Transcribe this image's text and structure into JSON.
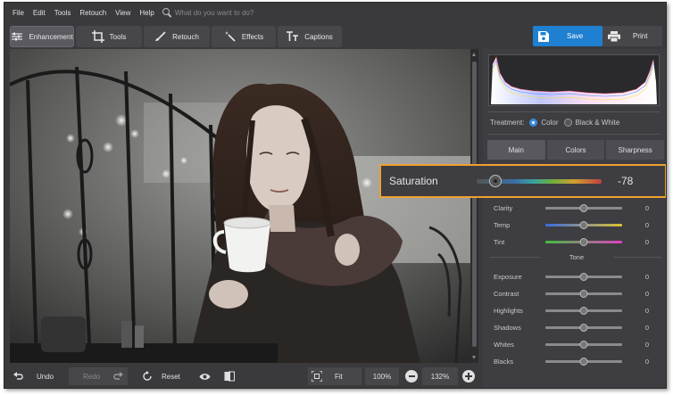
{
  "menu": [
    "File",
    "Edit",
    "Tools",
    "Retouch",
    "View",
    "Help"
  ],
  "search": {
    "placeholder": "What do you want to do?"
  },
  "toolbar": {
    "tabs": [
      {
        "label": "Enhancement",
        "icon": "sliders-icon"
      },
      {
        "label": "Tools",
        "icon": "crop-icon"
      },
      {
        "label": "Retouch",
        "icon": "brush-icon"
      },
      {
        "label": "Effects",
        "icon": "magic-wand-icon"
      },
      {
        "label": "Captions",
        "icon": "text-icon"
      }
    ],
    "save_label": "Save",
    "print_label": "Print"
  },
  "bottom_bar": {
    "undo_label": "Undo",
    "redo_label": "Redo",
    "reset_label": "Reset",
    "fit_label": "Fit",
    "zoom_actual": "100%",
    "zoom_current": "132%"
  },
  "panel": {
    "treatment_label": "Treatment:",
    "treatment_options": [
      "Color",
      "Black & White"
    ],
    "treatment_selected": "Color",
    "tabs": [
      "Main",
      "Colors",
      "Sharpness"
    ],
    "active_tab": "Main",
    "color_sliders": [
      {
        "label": "Clarity",
        "value": "0",
        "level": 0.5
      },
      {
        "label": "Temp",
        "value": "0",
        "level": 0.5
      },
      {
        "label": "Tint",
        "value": "0",
        "level": 0.5
      }
    ],
    "tone_label": "Tone",
    "tone_sliders": [
      {
        "label": "Exposure",
        "value": "0",
        "level": 0.5
      },
      {
        "label": "Contrast",
        "value": "0",
        "level": 0.5
      },
      {
        "label": "Highlights",
        "value": "0",
        "level": 0.5
      },
      {
        "label": "Shadows",
        "value": "0",
        "level": 0.5
      },
      {
        "label": "Whites",
        "value": "0",
        "level": 0.5
      },
      {
        "label": "Blacks",
        "value": "0",
        "level": 0.5
      }
    ]
  },
  "saturation_callout": {
    "label": "Saturation",
    "value": "-78",
    "level": 0.15
  },
  "colors": {
    "accent": "#1f7fd0",
    "highlight": "#f0a030",
    "background": "#3a3a3d"
  }
}
